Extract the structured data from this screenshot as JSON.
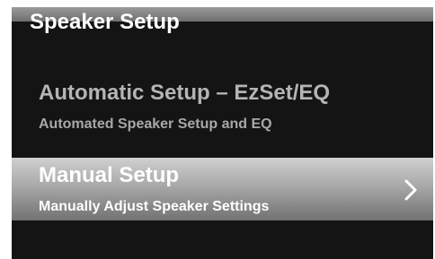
{
  "header": {
    "title": "Speaker Setup"
  },
  "menu": {
    "items": [
      {
        "title": "Automatic Setup – EzSet/EQ",
        "subtitle": "Automated Speaker Setup and EQ",
        "selected": false
      },
      {
        "title": "Manual Setup",
        "subtitle": "Manually Adjust Speaker Settings",
        "selected": true,
        "icon": "chevron-right-icon"
      }
    ]
  },
  "colors": {
    "background": "#141414",
    "highlight": "#a8a8a8",
    "text_active": "#ffffff",
    "text_inactive": "#b4b4b4"
  }
}
